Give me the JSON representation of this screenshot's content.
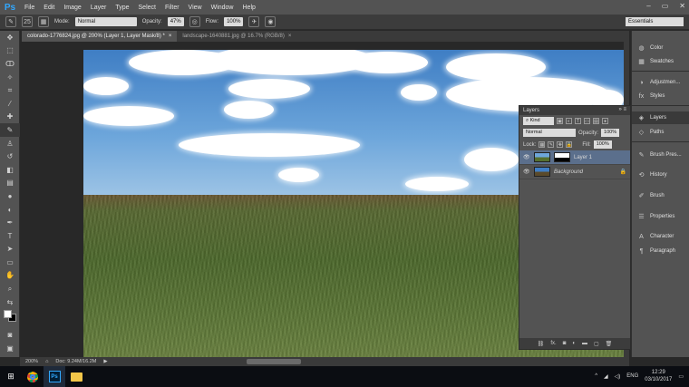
{
  "app": {
    "logo": "Ps"
  },
  "menu": [
    "File",
    "Edit",
    "Image",
    "Layer",
    "Type",
    "Select",
    "Filter",
    "View",
    "Window",
    "Help"
  ],
  "window_controls": [
    "–",
    "▭",
    "✕"
  ],
  "options": {
    "brush_size": "25",
    "mode_label": "Mode:",
    "mode_value": "Normal",
    "opacity_label": "Opacity:",
    "opacity_value": "47%",
    "flow_label": "Flow:",
    "flow_value": "100%",
    "workspace": "Essentials"
  },
  "tabs": [
    {
      "label": "colorado-1776824.jpg @ 200% (Layer 1, Layer Mask/8) *",
      "close": "×"
    },
    {
      "label": "landscape-1640881.jpg @ 16.7% (RGB/8)",
      "close": "×"
    }
  ],
  "status": {
    "zoom": "200%",
    "doc": "Doc: 9.24M/16.2M"
  },
  "dock": {
    "group1": [
      {
        "label": "Color",
        "icon": "color-icon"
      },
      {
        "label": "Swatches",
        "icon": "swatches-icon"
      }
    ],
    "group2": [
      {
        "label": "Adjustmen...",
        "icon": "adjustments-icon"
      },
      {
        "label": "Styles",
        "icon": "styles-icon"
      }
    ],
    "group3": [
      {
        "label": "Layers",
        "icon": "layers-icon"
      },
      {
        "label": "Paths",
        "icon": "paths-icon"
      }
    ],
    "group4": [
      {
        "label": "Brush Pres...",
        "icon": "brush-presets-icon"
      },
      {
        "label": "History",
        "icon": "history-icon"
      },
      {
        "label": "Brush",
        "icon": "brush-icon"
      },
      {
        "label": "Properties",
        "icon": "properties-icon"
      },
      {
        "label": "Character",
        "icon": "character-icon"
      },
      {
        "label": "Paragraph",
        "icon": "paragraph-icon"
      }
    ]
  },
  "layers_panel": {
    "title": "Layers",
    "filter_kind": "Kind",
    "blend_mode": "Normal",
    "opacity_label": "Opacity:",
    "opacity_value": "100%",
    "lock_label": "Lock:",
    "fill_label": "Fill:",
    "fill_value": "100%",
    "layers": [
      {
        "name": "Layer 1"
      },
      {
        "name": "Background"
      }
    ],
    "footer_icons": [
      "link-icon",
      "fx-icon",
      "mask-icon",
      "adjustment-icon",
      "folder-icon",
      "new-layer-icon",
      "trash-icon"
    ],
    "fx_text": "fx."
  },
  "taskbar": {
    "lang": "ENG",
    "time": "12:29",
    "date": "03/10/2017"
  },
  "colors": {
    "accent": "#31a8ff",
    "panel": "#535353",
    "dark": "#282828",
    "selected_layer": "#5b6f8c"
  }
}
